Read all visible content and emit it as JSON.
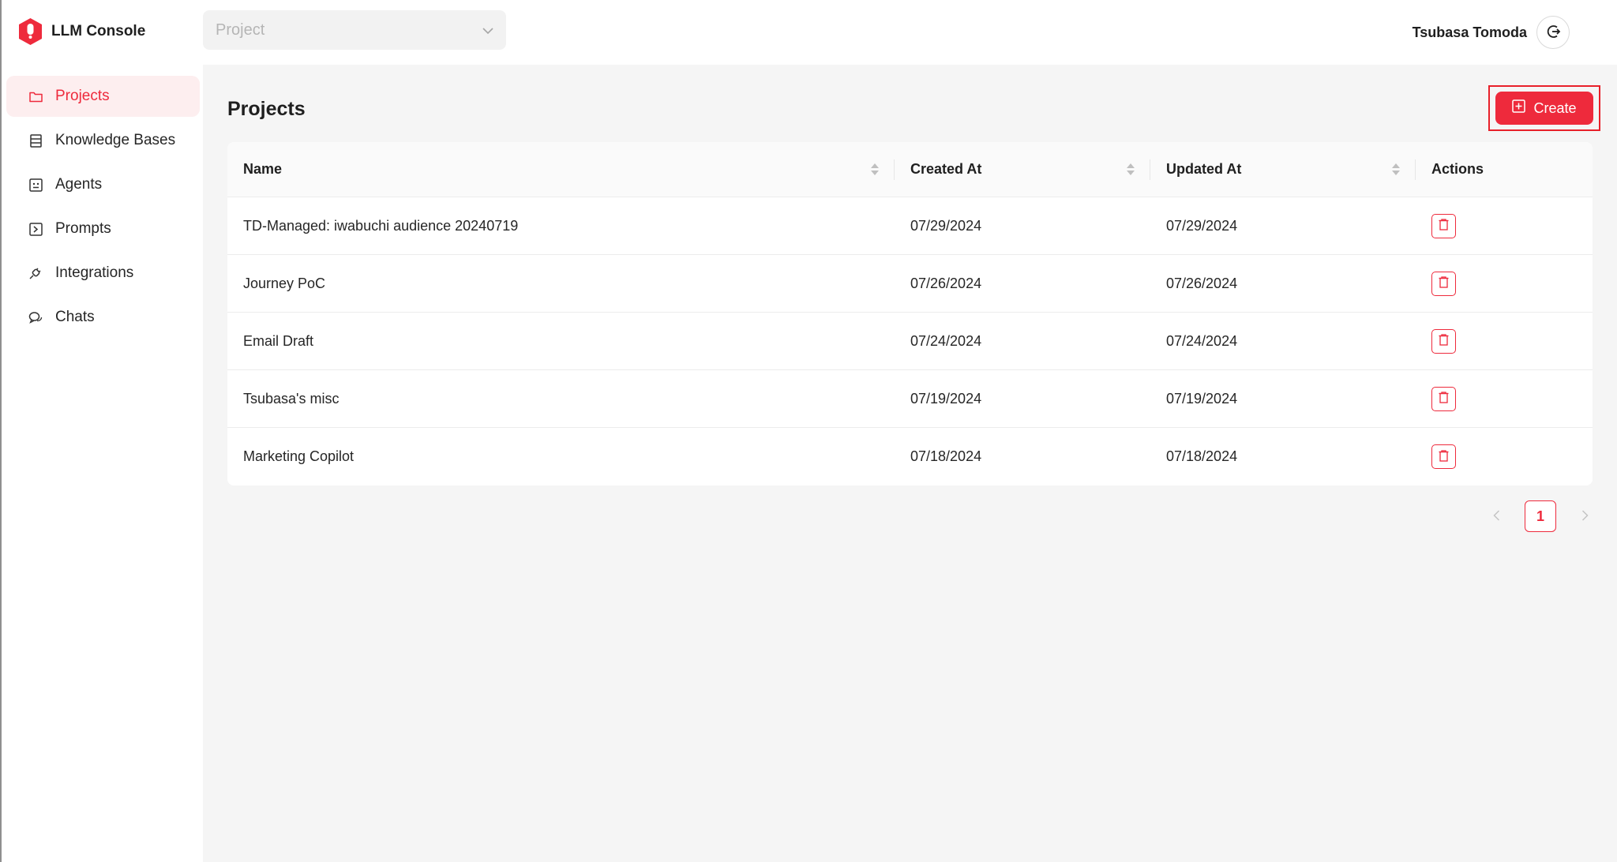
{
  "app": {
    "title": "LLM Console",
    "accent_color": "#ee2a3c"
  },
  "sidebar": {
    "items": [
      {
        "label": "Projects",
        "icon": "folder-icon",
        "active": true
      },
      {
        "label": "Knowledge Bases",
        "icon": "database-icon",
        "active": false
      },
      {
        "label": "Agents",
        "icon": "agent-icon",
        "active": false
      },
      {
        "label": "Prompts",
        "icon": "prompt-icon",
        "active": false
      },
      {
        "label": "Integrations",
        "icon": "plug-icon",
        "active": false
      },
      {
        "label": "Chats",
        "icon": "chat-icon",
        "active": false
      }
    ]
  },
  "header": {
    "project_select_placeholder": "Project",
    "user_name": "Tsubasa Tomoda"
  },
  "main": {
    "title": "Projects",
    "create_label": "Create",
    "table": {
      "columns": [
        "Name",
        "Created At",
        "Updated At",
        "Actions"
      ],
      "rows": [
        {
          "name": "TD-Managed: iwabuchi audience 20240719",
          "created": "07/29/2024",
          "updated": "07/29/2024"
        },
        {
          "name": "Journey PoC",
          "created": "07/26/2024",
          "updated": "07/26/2024"
        },
        {
          "name": "Email Draft",
          "created": "07/24/2024",
          "updated": "07/24/2024"
        },
        {
          "name": "Tsubasa's misc",
          "created": "07/19/2024",
          "updated": "07/19/2024"
        },
        {
          "name": "Marketing Copilot",
          "created": "07/18/2024",
          "updated": "07/18/2024"
        }
      ]
    },
    "pagination": {
      "current_page": "1"
    }
  }
}
